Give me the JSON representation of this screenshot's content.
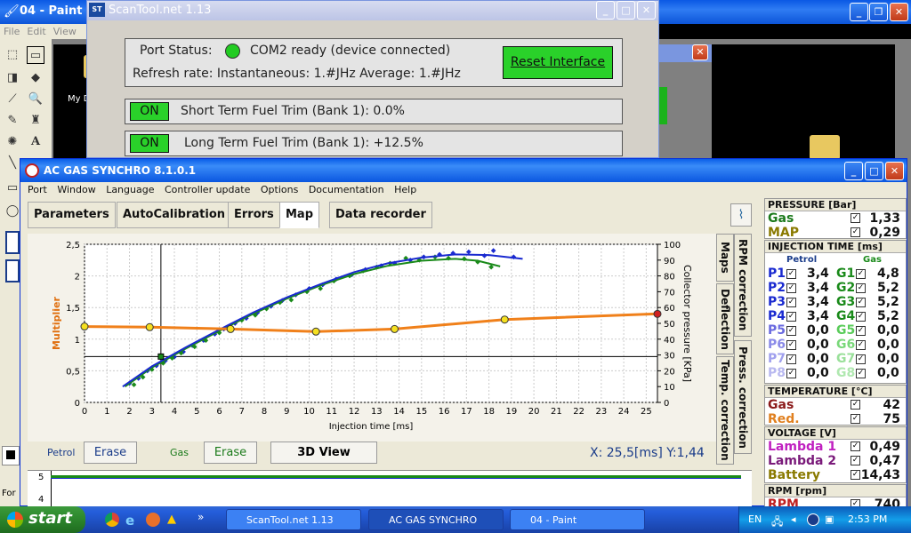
{
  "paint": {
    "title": "04 - Paint",
    "menu": [
      "File",
      "Edit",
      "View"
    ],
    "desktop_label": "My D",
    "for_label": "For"
  },
  "scantool": {
    "title": "ScanTool.net 1.13",
    "port_status_label": "Port Status:",
    "port_status_text": "COM2 ready (device connected)",
    "refresh_text": "Refresh rate: Instantaneous:  1.#JHz    Average:  1.#JHz",
    "reset_button": "Reset Interface",
    "rows": [
      {
        "state": "ON",
        "text": "Short Term Fuel Trim (Bank 1): 0.0%"
      },
      {
        "state": "ON",
        "text": "Long Term Fuel Trim (Bank 1): +12.5%"
      }
    ]
  },
  "acgas": {
    "title": "AC GAS SYNCHRO  8.1.0.1",
    "menu": [
      "Port",
      "Window",
      "Language",
      "Controller update",
      "Options",
      "Documentation",
      "Help"
    ],
    "tabs": [
      "Parameters",
      "AutoCalibration",
      "Errors",
      "Map",
      "Data recorder"
    ],
    "active_tab": "Map",
    "vtabs": [
      "Maps",
      "RPM correction",
      "Deflection",
      "Press. correction",
      "Temp. correction"
    ],
    "bottom": {
      "petrol_label": "Petrol",
      "erase1": "Erase",
      "gas_label": "Gas",
      "erase2": "Erase",
      "view3d": "3D View",
      "coords": "X: 25,5[ms]  Y:1,44"
    },
    "lower_chart_ticks": [
      "5",
      "4"
    ],
    "panel": {
      "pressure_head": "PRESSURE [Bar]",
      "pressure": [
        {
          "label": "Gas",
          "value": "1,33",
          "color": "#1c7a1c"
        },
        {
          "label": "MAP",
          "value": "0,29",
          "color": "#8a7a00"
        }
      ],
      "injection_head": "INJECTION TIME [ms]",
      "petrol_col": "Petrol",
      "gas_col": "Gas",
      "injection": [
        {
          "p": "P1",
          "pv": "3,4",
          "g": "G1",
          "gv": "4,8"
        },
        {
          "p": "P2",
          "pv": "3,4",
          "g": "G2",
          "gv": "5,2"
        },
        {
          "p": "P3",
          "pv": "3,4",
          "g": "G3",
          "gv": "5,2"
        },
        {
          "p": "P4",
          "pv": "3,4",
          "g": "G4",
          "gv": "5,2"
        },
        {
          "p": "P5",
          "pv": "0,0",
          "g": "G5",
          "gv": "0,0"
        },
        {
          "p": "P6",
          "pv": "0,0",
          "g": "G6",
          "gv": "0,0"
        },
        {
          "p": "P7",
          "pv": "0,0",
          "g": "G7",
          "gv": "0,0"
        },
        {
          "p": "P8",
          "pv": "0,0",
          "g": "G8",
          "gv": "0,0"
        }
      ],
      "temperature_head": "TEMPERATURE [°C]",
      "temperature": [
        {
          "label": "Gas",
          "value": "42",
          "color": "#8b1a1a"
        },
        {
          "label": "Red.",
          "value": "75",
          "color": "#e08020"
        }
      ],
      "voltage_head": "VOLTAGE [V]",
      "voltage": [
        {
          "label": "Lambda 1",
          "value": "0,49",
          "color": "#c020c0"
        },
        {
          "label": "Lambda 2",
          "value": "0,47",
          "color": "#7a1a7a"
        },
        {
          "label": "Battery",
          "value": "14,43",
          "color": "#8a7a00"
        }
      ],
      "rpm_head": "RPM [rpm]",
      "rpm": {
        "label": "RPM",
        "value": "740"
      }
    }
  },
  "chart_data": {
    "type": "scatter",
    "xlabel": "Injection time [ms]",
    "ylabel": "Multiplier",
    "y2label": "Collector pressure [KPa]",
    "xlim": [
      0,
      25.5
    ],
    "ylim": [
      0,
      2.5
    ],
    "y2lim": [
      0,
      100
    ],
    "xticks": [
      0,
      1,
      2,
      3,
      4,
      5,
      6,
      7,
      8,
      9,
      10,
      11,
      12,
      13,
      14,
      15,
      16,
      17,
      18,
      19,
      20,
      21,
      22,
      23,
      24,
      25
    ],
    "yticks": [
      "0",
      "0,5",
      "1",
      "1,5",
      "2",
      "2,5"
    ],
    "y2ticks": [
      0,
      10,
      20,
      30,
      40,
      50,
      60,
      70,
      80,
      90,
      100
    ],
    "crosshair": {
      "x": 3.4,
      "y2": 29
    },
    "multiplier": {
      "color": "#f0801a",
      "x": [
        0,
        2.9,
        6.5,
        10.3,
        13.8,
        18.7,
        25.5
      ],
      "y": [
        1.2,
        1.19,
        1.16,
        1.12,
        1.16,
        1.31,
        1.4
      ]
    },
    "petrol_curve": {
      "color": "#1a2ad0",
      "x": [
        1.7,
        3,
        4.5,
        6,
        7.5,
        9,
        10.5,
        12,
        13.5,
        15,
        16.5,
        18,
        19.5
      ],
      "y": [
        0.25,
        0.57,
        0.87,
        1.15,
        1.42,
        1.66,
        1.87,
        2.06,
        2.2,
        2.29,
        2.34,
        2.33,
        2.27
      ]
    },
    "gas_curve": {
      "color": "#1a8a1a",
      "x": [
        1.8,
        3,
        4.5,
        6,
        7.5,
        9,
        10.5,
        12,
        13.5,
        15,
        16.5,
        17.5,
        18.5
      ],
      "y": [
        0.25,
        0.55,
        0.85,
        1.13,
        1.4,
        1.64,
        1.85,
        2.03,
        2.16,
        2.24,
        2.27,
        2.24,
        2.15
      ]
    },
    "petrol_points": [
      [
        2,
        0.3
      ],
      [
        2.4,
        0.38
      ],
      [
        2.8,
        0.5
      ],
      [
        3.2,
        0.58
      ],
      [
        3.6,
        0.66
      ],
      [
        4,
        0.72
      ],
      [
        4.4,
        0.8
      ],
      [
        4.8,
        0.9
      ],
      [
        5.3,
        0.98
      ],
      [
        5.8,
        1.08
      ],
      [
        6.2,
        1.16
      ],
      [
        6.7,
        1.25
      ],
      [
        7.2,
        1.33
      ],
      [
        7.7,
        1.42
      ],
      [
        8.3,
        1.52
      ],
      [
        8.8,
        1.61
      ],
      [
        9.4,
        1.7
      ],
      [
        10,
        1.8
      ],
      [
        10.6,
        1.86
      ],
      [
        11.2,
        1.95
      ],
      [
        11.9,
        2.02
      ],
      [
        12.5,
        2.1
      ],
      [
        13.2,
        2.16
      ],
      [
        13.8,
        2.2
      ],
      [
        14.5,
        2.25
      ],
      [
        15.1,
        2.3
      ],
      [
        15.8,
        2.34
      ],
      [
        16.4,
        2.36
      ],
      [
        17.1,
        2.38
      ],
      [
        17.8,
        2.32
      ],
      [
        18.2,
        2.4
      ],
      [
        19.1,
        2.3
      ]
    ],
    "gas_points": [
      [
        2.2,
        0.28
      ],
      [
        2.6,
        0.4
      ],
      [
        3,
        0.52
      ],
      [
        3.5,
        0.62
      ],
      [
        3.9,
        0.7
      ],
      [
        4.3,
        0.78
      ],
      [
        4.9,
        0.88
      ],
      [
        5.4,
        0.98
      ],
      [
        6,
        1.1
      ],
      [
        6.5,
        1.2
      ],
      [
        7,
        1.3
      ],
      [
        7.6,
        1.38
      ],
      [
        8.1,
        1.48
      ],
      [
        8.7,
        1.58
      ],
      [
        9.2,
        1.62
      ],
      [
        9.9,
        1.75
      ],
      [
        10.5,
        1.8
      ],
      [
        11.1,
        1.92
      ],
      [
        11.8,
        2
      ],
      [
        12.4,
        2.08
      ],
      [
        13,
        2.14
      ],
      [
        13.6,
        2.2
      ],
      [
        14.3,
        2.28
      ],
      [
        14.9,
        2.25
      ],
      [
        15.6,
        2.3
      ],
      [
        16.2,
        2.28
      ],
      [
        16.9,
        2.27
      ],
      [
        17.5,
        2.22
      ],
      [
        18.1,
        2.14
      ]
    ]
  },
  "taskbar": {
    "start": "start",
    "tasks": [
      "ScanTool.net 1.13",
      "AC GAS SYNCHRO",
      "04 - Paint"
    ],
    "lang": "EN",
    "time": "2:53 PM"
  }
}
